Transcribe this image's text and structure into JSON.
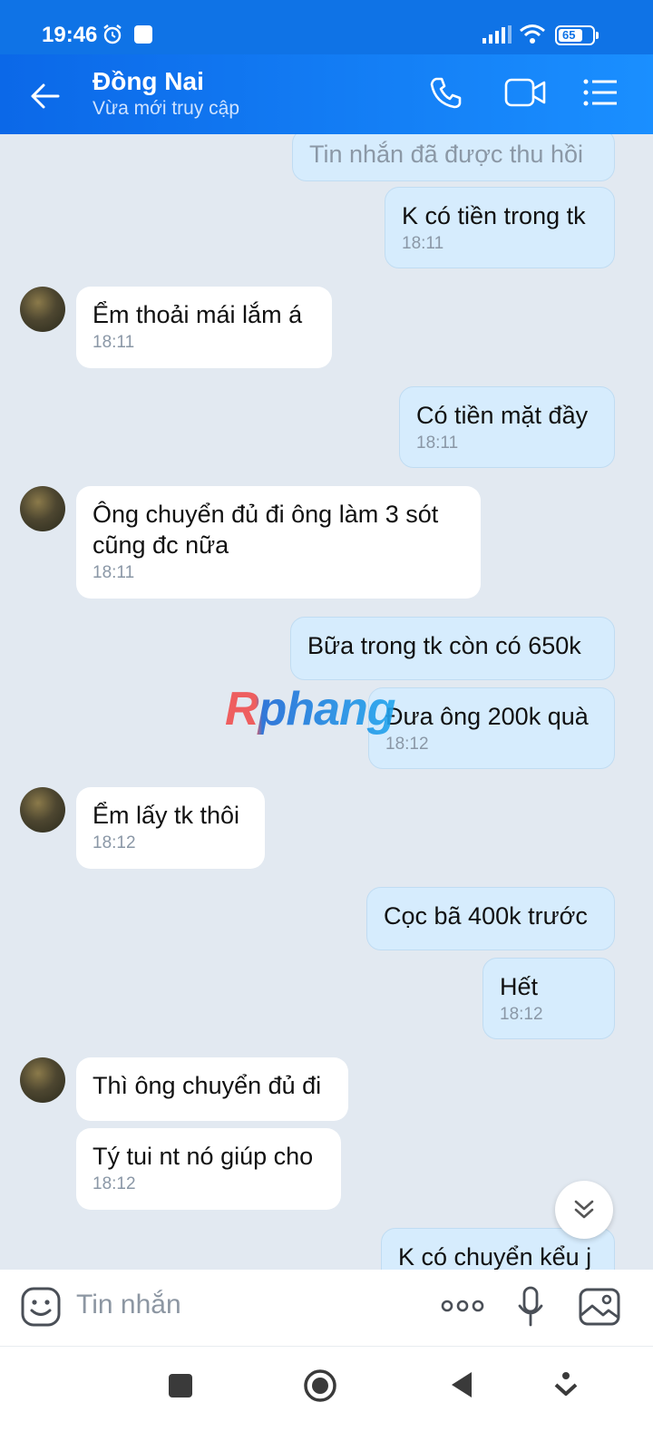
{
  "status": {
    "time": "19:46",
    "battery": "65"
  },
  "header": {
    "name": "Đồng Nai",
    "subtitle": "Vừa mới truy cập"
  },
  "messages": [
    {
      "side": "mine",
      "text": "Tin nhắn đã được thu hồi",
      "time": ""
    },
    {
      "side": "mine",
      "text": "K có tiền trong tk",
      "time": "18:11"
    },
    {
      "side": "theirs",
      "text": "Ểm thoải mái lắm á",
      "time": "18:11"
    },
    {
      "side": "mine",
      "text": "Có tiền mặt đầy",
      "time": "18:11"
    },
    {
      "side": "theirs",
      "text": "Ông chuyển đủ đi ông làm 3 sót cũng đc nữa",
      "time": "18:11"
    },
    {
      "side": "mine",
      "text": "Bữa trong tk còn có 650k",
      "time": ""
    },
    {
      "side": "mine",
      "text": "Đưa ông 200k quà",
      "time": "18:12"
    },
    {
      "side": "theirs",
      "text": "Ểm lấy tk thôi",
      "time": "18:12"
    },
    {
      "side": "mine",
      "text": "Cọc bã 400k trước",
      "time": ""
    },
    {
      "side": "mine",
      "text": "Hết",
      "time": "18:12"
    },
    {
      "side": "theirs",
      "text": "Thì ông chuyển đủ đi",
      "time": ""
    },
    {
      "side": "theirs",
      "text": "Tý tui nt nó giúp cho",
      "time": "18:12"
    },
    {
      "side": "mine",
      "text": "K có chuyển kểu j",
      "time": ""
    }
  ],
  "watermark": "Rphang",
  "input": {
    "placeholder": "Tin nhắn"
  },
  "colors": {
    "header": "#0f73e6",
    "mine_bubble": "#d6ecfd",
    "theirs_bubble": "#ffffff",
    "background": "#e2e9f1"
  }
}
